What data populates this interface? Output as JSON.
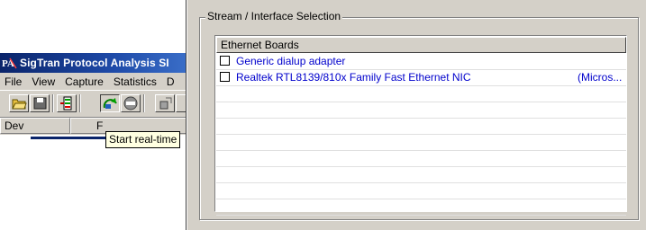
{
  "app": {
    "title": "SigTran Protocol Analysis SI",
    "logo_text": "PA",
    "menu": [
      "File",
      "View",
      "Capture",
      "Statistics",
      "D"
    ],
    "columns": [
      "Dev",
      "F"
    ],
    "tooltip": "Start real-time"
  },
  "dialog": {
    "group_label": "Stream / Interface Selection",
    "list_header": "Ethernet Boards",
    "rows": [
      {
        "name": "Generic dialup adapter",
        "extra": "",
        "checked": false
      },
      {
        "name": "Realtek RTL8139/810x Family Fast Ethernet NIC",
        "extra": "(Micros...",
        "checked": false
      },
      {
        "name": "",
        "extra": ""
      },
      {
        "name": "",
        "extra": ""
      },
      {
        "name": "",
        "extra": ""
      },
      {
        "name": "",
        "extra": ""
      },
      {
        "name": "",
        "extra": ""
      },
      {
        "name": "",
        "extra": ""
      },
      {
        "name": "",
        "extra": ""
      },
      {
        "name": "",
        "extra": ""
      }
    ]
  },
  "colors": {
    "title_bar": "#0a246a",
    "link_text": "#0000cc",
    "tooltip_bg": "#ffffe1",
    "dialog_bg": "#d4d0c8"
  },
  "icons": [
    "open-folder-icon",
    "save-icon",
    "capture-filter-icon",
    "start-realtime-icon",
    "stop-icon",
    "next-icon"
  ]
}
